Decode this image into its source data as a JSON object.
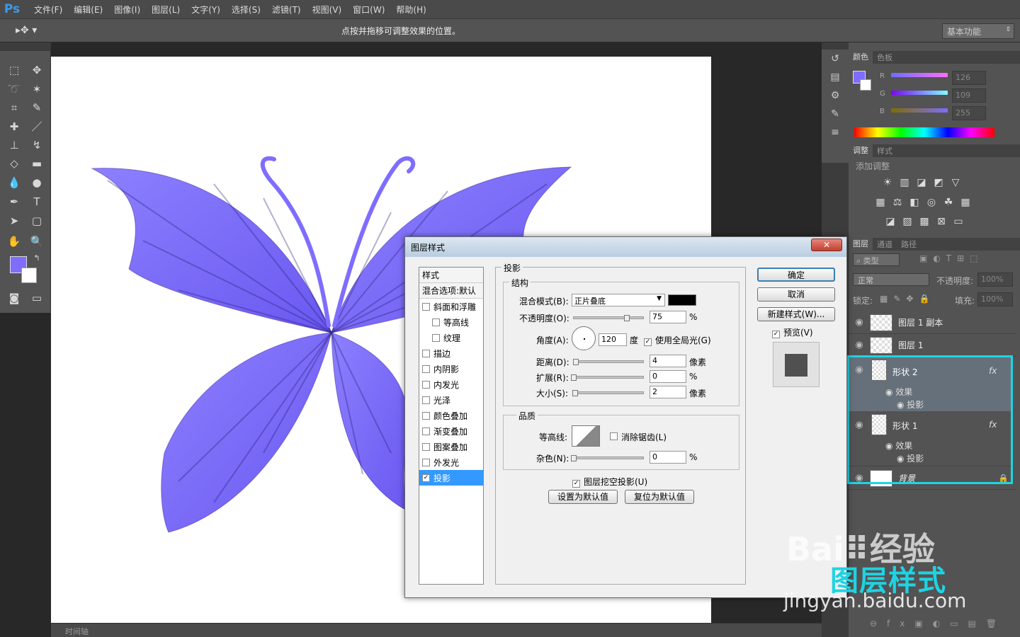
{
  "app": {
    "logo": "Ps",
    "menus": [
      "文件(F)",
      "编辑(E)",
      "图像(I)",
      "图层(L)",
      "文字(Y)",
      "选择(S)",
      "滤镜(T)",
      "视图(V)",
      "窗口(W)",
      "帮助(H)"
    ]
  },
  "options": {
    "hint": "点按并拖移可调整效果的位置。",
    "workspace": "基本功能"
  },
  "timeline": {
    "label": "时间轴"
  },
  "color_panel": {
    "tabs": [
      "颜色",
      "色板"
    ],
    "r": "126",
    "g": "109",
    "b": "255",
    "labels": [
      "R",
      "G",
      "B"
    ]
  },
  "adjust_panel": {
    "tabs": [
      "调整",
      "样式"
    ],
    "title": "添加调整"
  },
  "layers_panel": {
    "tabs": [
      "图层",
      "通道",
      "路径"
    ],
    "filter": "类型",
    "blend": "正常",
    "opacity_label": "不透明度:",
    "opacity": "100%",
    "lock_label": "锁定:",
    "fill_label": "填充:",
    "fill": "100%",
    "layers": [
      {
        "name": "图层 1 副本"
      },
      {
        "name": "图层 1"
      },
      {
        "name": "形状 2",
        "fx": "fx",
        "effect": "效果",
        "sub": "投影"
      },
      {
        "name": "形状 1",
        "fx": "fx",
        "effect": "效果",
        "sub": "投影"
      },
      {
        "name": "背景"
      }
    ]
  },
  "dialog": {
    "title": "图层样式",
    "close": "✕",
    "styles_header": "样式",
    "blend_options": "混合选项:默认",
    "styles": [
      {
        "label": "斜面和浮雕",
        "checked": false
      },
      {
        "label": "等高线",
        "checked": false,
        "indent": true
      },
      {
        "label": "纹理",
        "checked": false,
        "indent": true
      },
      {
        "label": "描边",
        "checked": false
      },
      {
        "label": "内阴影",
        "checked": false
      },
      {
        "label": "内发光",
        "checked": false
      },
      {
        "label": "光泽",
        "checked": false
      },
      {
        "label": "颜色叠加",
        "checked": false
      },
      {
        "label": "渐变叠加",
        "checked": false
      },
      {
        "label": "图案叠加",
        "checked": false
      },
      {
        "label": "外发光",
        "checked": false
      },
      {
        "label": "投影",
        "checked": true
      }
    ],
    "section": "投影",
    "structure": "结构",
    "quality": "品质",
    "blend_mode_label": "混合模式(B):",
    "blend_mode": "正片叠底",
    "shadow_color": "#000000",
    "opacity_label": "不透明度(O):",
    "opacity": "75",
    "opacity_unit": "%",
    "angle_label": "角度(A):",
    "angle": "120",
    "angle_unit": "度",
    "global_light": "使用全局光(G)",
    "distance_label": "距离(D):",
    "distance": "4",
    "distance_unit": "像素",
    "spread_label": "扩展(R):",
    "spread": "0",
    "spread_unit": "%",
    "size_label": "大小(S):",
    "size": "2",
    "size_unit": "像素",
    "contour_label": "等高线:",
    "antialias": "消除锯齿(L)",
    "noise_label": "杂色(N):",
    "noise": "0",
    "noise_unit": "%",
    "knockout": "图层挖空投影(U)",
    "set_default": "设置为默认值",
    "reset_default": "复位为默认值",
    "ok": "确定",
    "cancel": "取消",
    "new_style": "新建样式(W)...",
    "preview": "预览(V)"
  },
  "watermark": {
    "brand": "Bai",
    "brand2": "经验",
    "site": "jingyan.baidu.com",
    "annotation": "图层样式"
  },
  "colors": {
    "butterfly": "#7e6dff",
    "fg": "#7e6dff",
    "bg": "#ffffff",
    "highlight": "#1fd3e3"
  }
}
